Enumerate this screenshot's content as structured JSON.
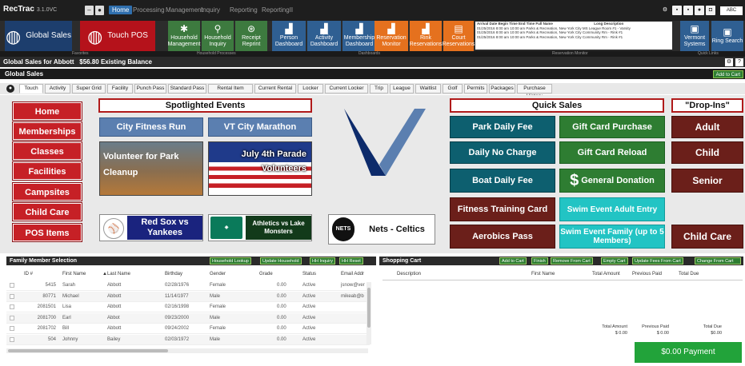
{
  "app": {
    "name": "RecTrac",
    "version": "3.1.0VC"
  },
  "menu": {
    "tabs": [
      "Home",
      "Processing",
      "Management",
      "Inquiry",
      "Reporting",
      "ReportingII"
    ],
    "active": "Home"
  },
  "toolbar": {
    "global_sales": "Global Sales",
    "touch_pos": "Touch POS",
    "household_mgmt": [
      "Household",
      "Management"
    ],
    "household_inquiry": [
      "Household",
      "Inquiry"
    ],
    "receipt_reprint": [
      "Receipt",
      "Reprint"
    ],
    "person_dashboard": [
      "Person",
      "Dashboard"
    ],
    "activity_dashboard": [
      "Activity",
      "Dashboard"
    ],
    "membership_dashboard": [
      "Membership",
      "Dashboard"
    ],
    "reservation_monitor": [
      "Reservation",
      "Monitor"
    ],
    "rink_reservations": [
      "Rink",
      "Reservations"
    ],
    "court_reservations": [
      "Court",
      "Reservations"
    ],
    "vermont_systems": [
      "Vermont",
      "Systems"
    ],
    "ring_search": [
      "Ring Search"
    ],
    "groups": [
      "Favorites",
      "Household Processes",
      "Dashboards",
      "Reservation Monitor",
      "Quick Links"
    ],
    "right_label": "ABC"
  },
  "reservation_grid": {
    "headers": [
      "Arrival Date",
      "Begin Time",
      "End Time",
      "Full Name",
      "Long Description"
    ],
    "rows": [
      [
        "01/25/2016",
        "8:00 am",
        "10:00 am",
        "Parks & Recreation, New York City",
        "MS League Room #1 - Varsity"
      ],
      [
        "01/25/2016",
        "8:00 am",
        "10:00 am",
        "Parks & Recreation, New York City",
        "Community Rm - Rink #1"
      ],
      [
        "01/25/2016",
        "8:00 am",
        "10:00 am",
        "Parks & Recreation, New York City",
        "Community Rm - Rink #1"
      ]
    ]
  },
  "header": {
    "title": "Global Sales for Abbott",
    "balance": "$56.80 Existing Balance"
  },
  "section": {
    "title": "Global Sales",
    "add_to_cart": "Add to Cart"
  },
  "tabs": [
    "Touch",
    "Activity",
    "Super Grid",
    "Facility",
    "Punch Pass",
    "Standard Pass",
    "Rental Item",
    "Current Rental",
    "Locker",
    "Current Locker",
    "Trip",
    "League",
    "Waitlist",
    "Golf",
    "Permits",
    "Packages",
    "Purchase History"
  ],
  "nav": [
    "Home",
    "Memberships",
    "Classes",
    "Facilities",
    "Campsites",
    "Child Care",
    "POS Items"
  ],
  "spotlight": {
    "title": "Spotlighted Events",
    "tiles": [
      "City Fitness Run",
      "VT City Marathon",
      "Volunteer for Park Cleanup",
      "July 4th Parade Volunteers"
    ]
  },
  "games": [
    "Red Sox vs Yankees",
    "Athletics vs Lake Monsters",
    "Nets - Celtics"
  ],
  "quick_sales": {
    "title": "Quick Sales",
    "tiles": [
      "Park Daily Fee",
      "Gift Card Purchase",
      "Daily No Charge",
      "Gift Card Reload",
      "Boat Daily Fee",
      "General Donation",
      "Fitness Training Card",
      "Swim Event Adult Entry",
      "Aerobics Pass",
      "Swim Event Family (up to 5 Members)"
    ]
  },
  "drop_ins": {
    "title": "\"Drop-Ins\"",
    "tiles": [
      "Adult",
      "Child",
      "Senior",
      "Child Care"
    ]
  },
  "family": {
    "title": "Family Member Selection",
    "buttons": [
      "Household Lookup",
      "Update Household",
      "HH Inquiry",
      "HH Reset"
    ],
    "columns": [
      "ID #",
      "First Name",
      "Last Name",
      "Birthday",
      "Gender",
      "Grade",
      "Status",
      "Email Addr"
    ],
    "rows": [
      [
        "5415",
        "Sarah",
        "Abbott",
        "02/28/1976",
        "Female",
        "0.00",
        "Active",
        "jsnow@ver"
      ],
      [
        "80771",
        "Michael",
        "Abbott",
        "11/14/1977",
        "Male",
        "0.00",
        "Active",
        "mikeab@b"
      ],
      [
        "2081501",
        "Lisa",
        "Abbott",
        "02/16/1998",
        "Female",
        "0.00",
        "Active",
        ""
      ],
      [
        "2081700",
        "Earl",
        "Abbot",
        "09/23/2000",
        "Male",
        "0.00",
        "Active",
        ""
      ],
      [
        "2081702",
        "Bill",
        "Abbott",
        "09/24/2002",
        "Female",
        "0.00",
        "Active",
        ""
      ],
      [
        "504",
        "Johnny",
        "Bailey",
        "02/03/1972",
        "Male",
        "0.00",
        "Active",
        ""
      ]
    ]
  },
  "cart": {
    "title": "Shopping Cart",
    "buttons": [
      "Add to Cart",
      "Finish",
      "Remove From Cart",
      "Empty Cart",
      "Update Fees From Cart",
      "Change From Cart"
    ],
    "columns": [
      "Description",
      "First Name",
      "Total Amount",
      "Previous Paid",
      "Total Due"
    ],
    "totals": {
      "total_amount_label": "Total Amount",
      "total_amount": "$ 0.00",
      "previous_paid_label": "Previous Paid",
      "previous_paid": "$ 0.00",
      "total_due_label": "Total Due",
      "total_due": "$0.00"
    },
    "payment": "$0.00 Payment"
  },
  "colors": {
    "red": "#c62026",
    "teal": "#0d5f6f",
    "green": "#2e7d32",
    "maroon": "#6b1f1a",
    "cyan": "#22c4c4",
    "blue": "#5b7fb0",
    "payment": "#22a33a"
  }
}
